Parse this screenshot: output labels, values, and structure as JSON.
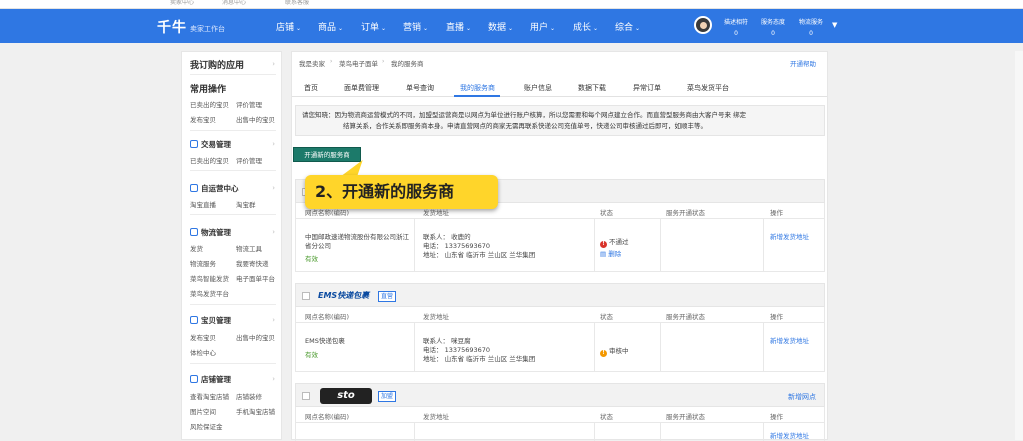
{
  "topstrip": {
    "links": [
      "卖家中心",
      "消息中心",
      "联系客服"
    ]
  },
  "app": {
    "logo": "千牛",
    "subtitle": "卖家工作台"
  },
  "nav": [
    {
      "label": "店铺"
    },
    {
      "label": "商品"
    },
    {
      "label": "订单"
    },
    {
      "label": "营销"
    },
    {
      "label": "直播"
    },
    {
      "label": "数据"
    },
    {
      "label": "用户"
    },
    {
      "label": "成长"
    },
    {
      "label": "综合"
    }
  ],
  "stats": [
    {
      "label": "描述相符",
      "value": "0"
    },
    {
      "label": "服务态度",
      "value": "0"
    },
    {
      "label": "物流服务",
      "value": "0"
    }
  ],
  "sidebar": {
    "title": "我订购的应用",
    "common_title": "常用操作",
    "common_links": [
      "已卖出的宝贝",
      "评价管理",
      "发布宝贝",
      "出售中的宝贝"
    ],
    "sections": [
      {
        "title": "交易管理",
        "links": [
          "已卖出的宝贝",
          "评价管理"
        ]
      },
      {
        "title": "自运营中心",
        "links": [
          "淘宝直播",
          "淘宝群"
        ]
      },
      {
        "title": "物流管理",
        "links": [
          "发货",
          "物流工具",
          "物流服务",
          "我要寄快递",
          "菜鸟智能发货",
          "电子面单平台",
          "菜鸟发货平台"
        ]
      },
      {
        "title": "宝贝管理",
        "links": [
          "发布宝贝",
          "出售中的宝贝",
          "体检中心"
        ]
      },
      {
        "title": "店铺管理",
        "links": [
          "查看淘宝店铺",
          "店铺装修",
          "图片空间",
          "手机淘宝店铺",
          "风险保证金"
        ]
      }
    ]
  },
  "breadcrumb": [
    "我是卖家",
    "菜鸟电子面单",
    "我的服务商"
  ],
  "help": "开通帮助",
  "tabs": [
    "首页",
    "面单费管理",
    "单号查询",
    "我的服务商",
    "账户信息",
    "数据下载",
    "异常订单",
    "菜鸟发货平台"
  ],
  "notice": {
    "line1": "请您知晓：因为物流商运营模式的不同，加盟型运营商是以网点为单位进行账户核算，所以您需要和每个网点建立合作。而直营型服务商由大客户号来 绑定",
    "line2": "结算关系，合作关系即服务商本身。申请直营网点的商家无需再联系快递公司充值单号，快递公司审核通过后即可，如顺丰等。"
  },
  "open_button": "开通新的服务商",
  "callout": "2、开通新的服务商",
  "columns": [
    "网点名称(编码)",
    "发货地址",
    "状态",
    "服务开通状态",
    "操作"
  ],
  "providers": [
    {
      "row": {
        "name": "中国邮政速递物流股份有限公司浙江省分公司",
        "effective": "有效",
        "contact": "联系人：  收鹿的",
        "phone": "电话：  13375693670",
        "address": "地址：  山东省 临沂市 兰山区 兰华集团",
        "status": "不通过",
        "status_action": "删除",
        "action": "新增发货地址"
      }
    },
    {
      "logo": "EMS快递包裹",
      "tag": "直营",
      "row": {
        "name": "EMS快递包裹",
        "effective": "有效",
        "contact": "联系人：  咪豆腐",
        "phone": "电话：  13375693670",
        "address": "地址：  山东省 临沂市 兰山区 兰华集团",
        "status": "审核中",
        "action": "新增发货地址"
      }
    },
    {
      "logo": "sto",
      "tag": "加盟",
      "add": "新增网点",
      "row": {
        "action": "新增发货地址"
      }
    }
  ],
  "colors": {
    "nav": "#2f77e3",
    "button": "#1c7a6a",
    "callout": "#ffd52a",
    "reject": "#d9342b",
    "pending": "#f39800"
  }
}
